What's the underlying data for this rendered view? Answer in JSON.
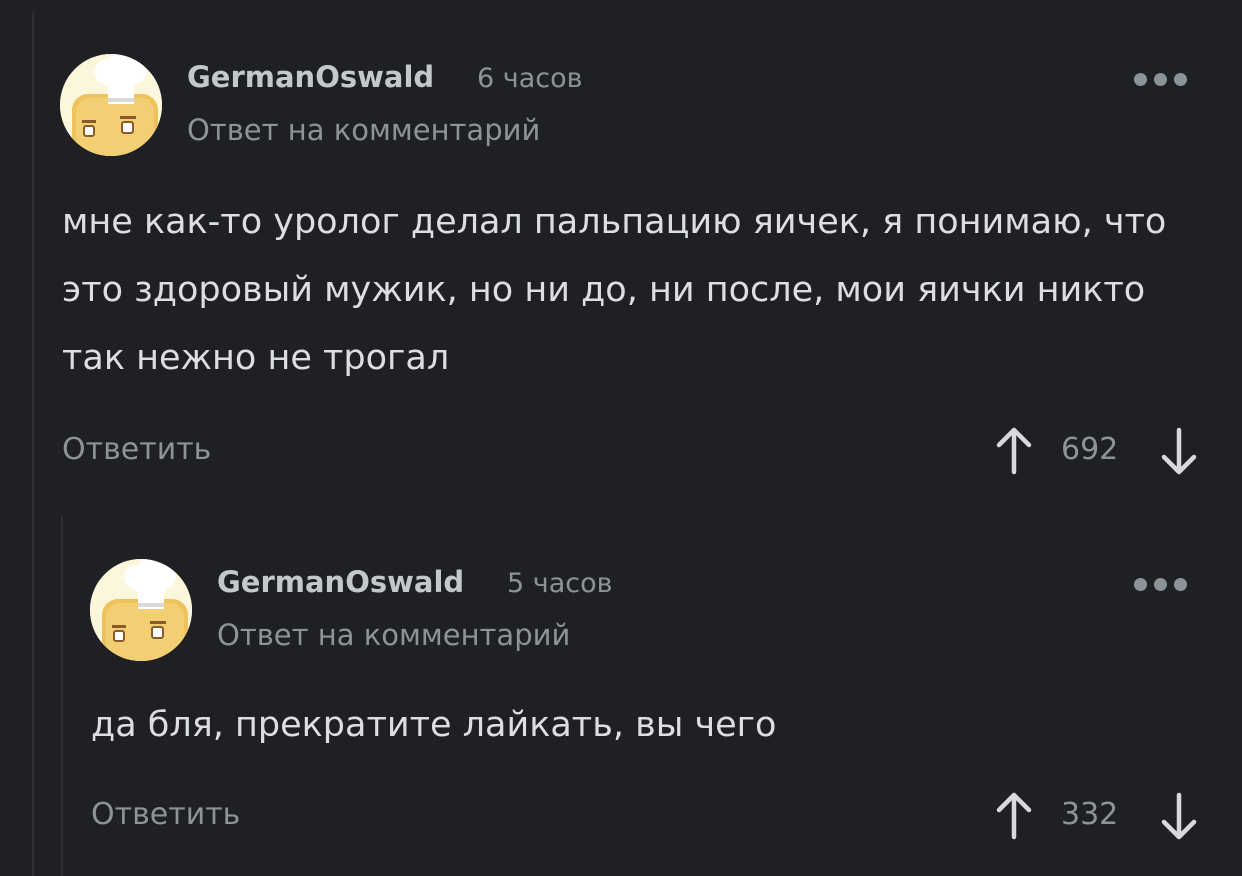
{
  "comments": [
    {
      "author": "GermanOswald",
      "time": "6 часов",
      "reply_note": "Ответ на комментарий",
      "text": "мне как-то уролог делал пальпацию яичек, я понимаю, что это здоровый мужик, но ни до, ни после, мои яички никто так нежно не трогал",
      "reply_label": "Ответить",
      "rating": "692",
      "avatar_icon": "chef-toast-icon",
      "more_icon": "more-dots-icon",
      "upvote_icon": "arrow-up-icon",
      "downvote_icon": "arrow-down-icon"
    },
    {
      "author": "GermanOswald",
      "time": "5 часов",
      "reply_note": "Ответ на комментарий",
      "text": "да бля, прекратите лайкать, вы чего",
      "reply_label": "Ответить",
      "rating": "332",
      "avatar_icon": "chef-toast-icon",
      "more_icon": "more-dots-icon",
      "upvote_icon": "arrow-up-icon",
      "downvote_icon": "arrow-down-icon"
    }
  ],
  "colors": {
    "background": "#1f2023",
    "thread_line": "#2e2f33",
    "author": "#c4c7cc",
    "muted": "#8f9298",
    "body_text": "#dcdee1",
    "avatar_bg": "#fcf6dd",
    "toast": "#efc35c"
  }
}
